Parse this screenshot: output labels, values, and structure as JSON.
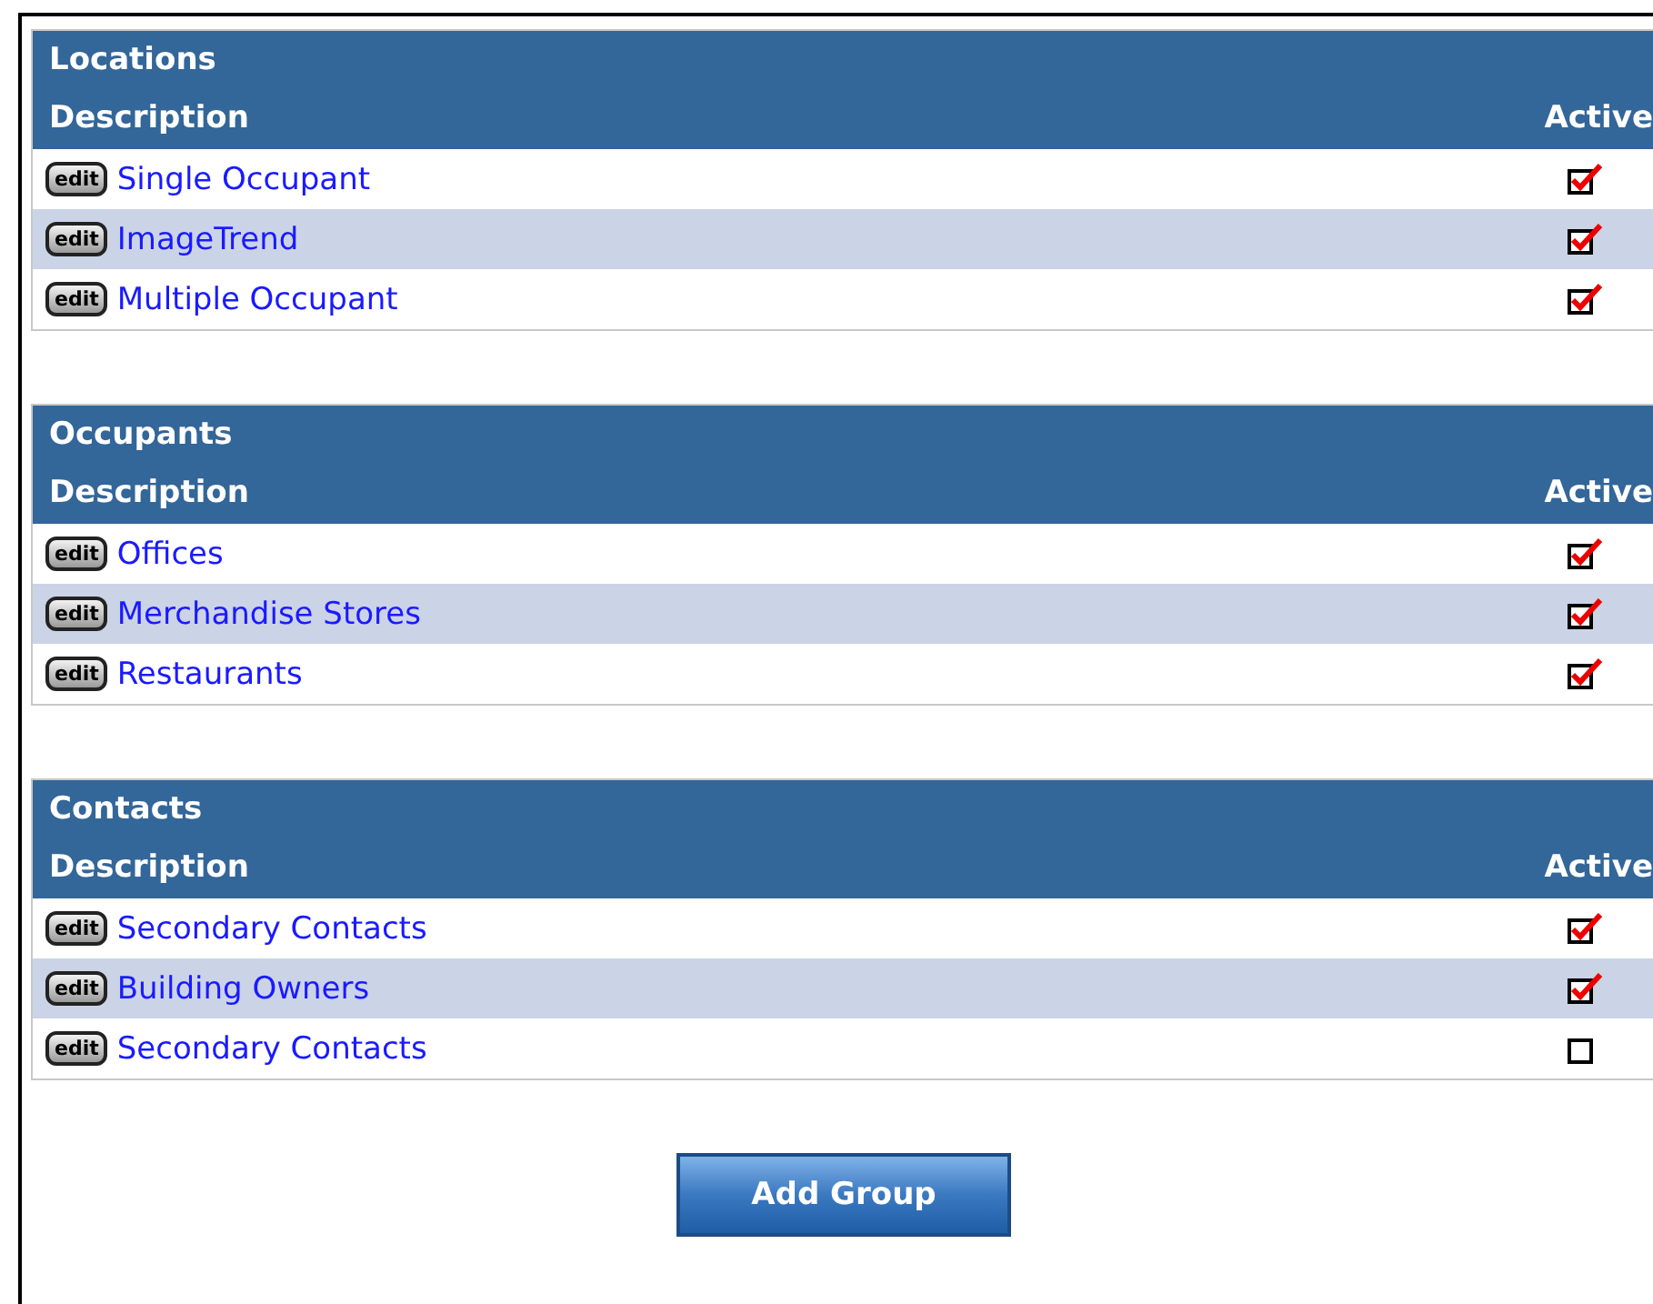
{
  "groups": [
    {
      "title": "Locations",
      "columns": [
        "Description",
        "Active"
      ],
      "rows": [
        {
          "edit": "edit",
          "description": "Single Occupant",
          "active": true
        },
        {
          "edit": "edit",
          "description": "ImageTrend",
          "active": true
        },
        {
          "edit": "edit",
          "description": "Multiple Occupant",
          "active": true
        }
      ]
    },
    {
      "title": "Occupants",
      "columns": [
        "Description",
        "Active"
      ],
      "rows": [
        {
          "edit": "edit",
          "description": "Offices",
          "active": true
        },
        {
          "edit": "edit",
          "description": "Merchandise Stores",
          "active": true
        },
        {
          "edit": "edit",
          "description": "Restaurants",
          "active": true
        }
      ]
    },
    {
      "title": "Contacts",
      "columns": [
        "Description",
        "Active"
      ],
      "rows": [
        {
          "edit": "edit",
          "description": "Secondary Contacts",
          "active": true
        },
        {
          "edit": "edit",
          "description": "Building Owners",
          "active": true
        },
        {
          "edit": "edit",
          "description": "Secondary Contacts",
          "active": false
        }
      ]
    }
  ],
  "add_button": "Add Group"
}
